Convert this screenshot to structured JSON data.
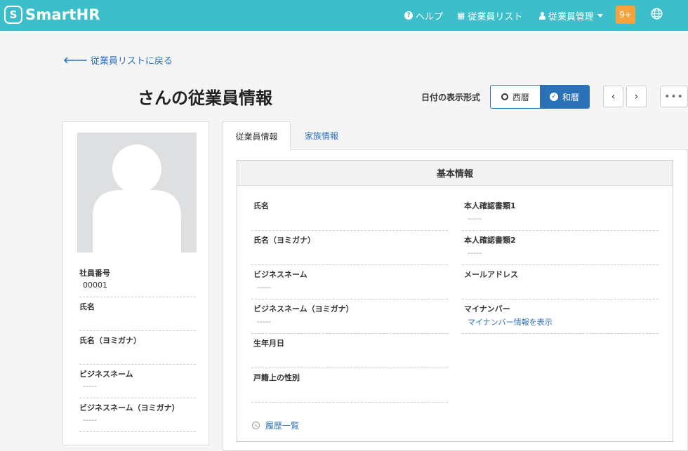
{
  "header": {
    "logo_mark": "S",
    "logo_text": "SmartHR",
    "help_icon": "?",
    "help": "ヘルプ",
    "list_icon": "▦",
    "employee_list": "従業員リスト",
    "admin_icon": "👤",
    "admin": "従業員管理",
    "notification_count": "9+",
    "colors": {
      "bar": "#3dbfcb",
      "badge": "#f8a23b"
    }
  },
  "page": {
    "back_arrow": "🡐",
    "back_link": "従業員リストに戻る",
    "title": "さんの従業員情報",
    "date_format_label": "日付の表示形式",
    "date_western": "西暦",
    "date_japanese": "和暦",
    "check_glyph": "✓",
    "prev": "‹",
    "next": "›",
    "more": "•••",
    "accent": "#2b71b8"
  },
  "sidebar": {
    "fields": [
      {
        "label": "社員番号",
        "value": "00001"
      },
      {
        "label": "氏名",
        "value": ""
      },
      {
        "label": "氏名（ヨミガナ）",
        "value": ""
      },
      {
        "label": "ビジネスネーム",
        "value": "-----"
      },
      {
        "label": "ビジネスネーム（ヨミガナ）",
        "value": "-----"
      }
    ]
  },
  "tabs": {
    "employee_info": "従業員情報",
    "family_info": "家族情報"
  },
  "basic_info": {
    "heading": "基本情報",
    "left": [
      {
        "label": "氏名",
        "value": ""
      },
      {
        "label": "氏名（ヨミガナ）",
        "value": ""
      },
      {
        "label": "ビジネスネーム",
        "value": "-----"
      },
      {
        "label": "ビジネスネーム（ヨミガナ）",
        "value": "-----"
      },
      {
        "label": "生年月日",
        "value": ""
      },
      {
        "label": "戸籍上の性別",
        "value": ""
      }
    ],
    "right": [
      {
        "label": "本人確認書類1",
        "value": "-----"
      },
      {
        "label": "本人確認書類2",
        "value": "-----"
      },
      {
        "label": "メールアドレス",
        "value": ""
      },
      {
        "label": "マイナンバー",
        "link": "マイナンバー情報を表示"
      }
    ],
    "history_link": "履歴一覧"
  }
}
